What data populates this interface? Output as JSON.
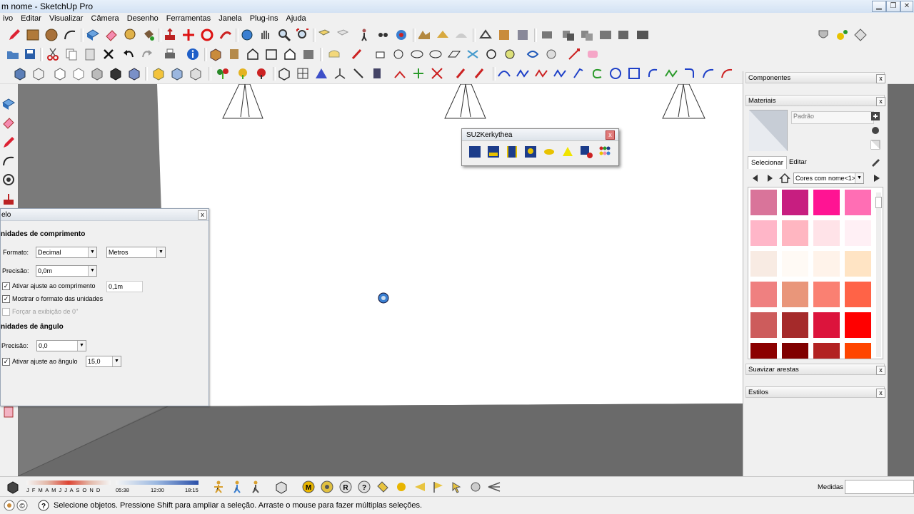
{
  "window": {
    "title": "m nome - SketchUp Pro",
    "min": "▁",
    "restore": "❐",
    "close": "✕"
  },
  "menu": [
    "ivo",
    "Editar",
    "Visualizar",
    "Câmera",
    "Desenho",
    "Ferramentas",
    "Janela",
    "Plug-ins",
    "Ajuda"
  ],
  "units_dialog": {
    "title": "elo",
    "length_section": "nidades de comprimento",
    "format_label": "Formato:",
    "format_value": "Decimal",
    "format_unit": "Metros",
    "precision_label": "Precisão:",
    "precision_value": "0,0m",
    "snap_length_label": "Ativar ajuste ao comprimento",
    "snap_length_value": "0,1m",
    "show_format_label": "Mostrar o formato das unidades",
    "force_label": "Forçar a exibição de 0\"",
    "angle_section": "nidades de ângulo",
    "angle_precision_label": "Precisão:",
    "angle_precision_value": "0,0",
    "snap_angle_label": "Ativar ajuste ao ângulo",
    "snap_angle_value": "15,0",
    "close": "x"
  },
  "su2k": {
    "title": "SU2Kerkythea",
    "close": "x"
  },
  "panel": {
    "components": "Componentes",
    "materials": "Materiais",
    "material_name": "Padrão",
    "tab_select": "Selecionar",
    "tab_edit": "Editar",
    "collection": "Cores com nome<1>",
    "smooth": "Suavizar arestas",
    "styles": "Estilos",
    "close": "x",
    "swatches": [
      "#d9749a",
      "#c71e80",
      "#ff1493",
      "#ff6eb4",
      "#ffb6c8",
      "#ffb6c1",
      "#ffe3e8",
      "#fff0f5",
      "#f8ebe3",
      "#fffaf5",
      "#fff3ea",
      "#ffe4c4",
      "#ef8080",
      "#e9967a",
      "#fa8072",
      "#ff6347",
      "#cd5c5c",
      "#a52a2a",
      "#dc143c",
      "#ff0000",
      "#8b0000",
      "#800000",
      "#b22222",
      "#ff4500"
    ]
  },
  "shadow": {
    "months": "J F M A M J J A S O N D",
    "time_start": "05:38",
    "time_mid": "12:00",
    "time_end": "18:15"
  },
  "measures_label": "Medidas",
  "status_text": "Selecione objetos. Pressione Shift para ampliar a seleção. Arraste o mouse para fazer múltiplas seleções.",
  "colors": {
    "wall": "#ffffff",
    "floor": "#6d6d6d",
    "chrome": "#f0f0f0"
  }
}
